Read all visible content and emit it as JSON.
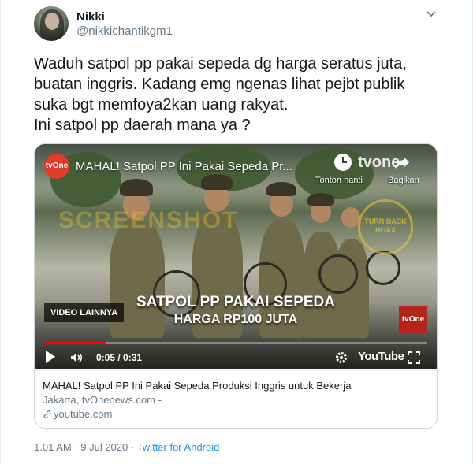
{
  "user": {
    "name": "Nikki",
    "handle": "@nikkichantikgm1"
  },
  "tweet": {
    "text": "Waduh satpol pp pakai sepeda dg harga seratus juta,\nbuatan inggris. Kadang emg ngenas lihat pejbt publik\nsuka bgt memfoya2kan uang rakyat.\nIni satpol pp daerah mana ya ?"
  },
  "video": {
    "channel_logo": "tvOne",
    "title": "MAHAL! Satpol PP Ini Pakai Sepeda Pr...",
    "watch_later_label": "Tonton nanti",
    "share_label": "Bagikan",
    "top_logo": "tvone",
    "watermark": "SCREENSHOT",
    "seal_text": "TURN BACK HOAX",
    "more_videos": "VIDEO LAINNYA",
    "caption_line1": "SATPOL PP PAKAI SEPEDA",
    "caption_line2": "HARGA RP100 JUTA",
    "corner_logo": "tvOne",
    "time": "0:05 / 0:31",
    "progress_fraction": 0.16,
    "brand": "YouTube"
  },
  "card": {
    "title": "MAHAL! Satpol PP Ini Pakai Sepeda Produksi Inggris untuk Bekerja",
    "description": "Jakarta, tvOnenews.com -",
    "domain": "youtube.com"
  },
  "footer": {
    "timestamp": "1.01 AM · 9 Jul 2020 · ",
    "source": "Twitter for Android"
  },
  "colors": {
    "link": "#1b95e0",
    "secondary_text": "#657786",
    "progress": "#ff0000"
  }
}
